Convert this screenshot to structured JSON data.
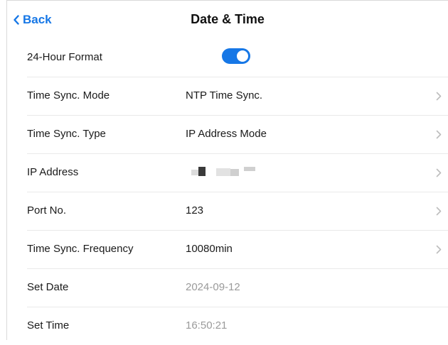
{
  "header": {
    "back_label": "Back",
    "title": "Date & Time"
  },
  "rows": [
    {
      "label": "24-Hour Format",
      "toggle_on": true
    },
    {
      "label": "Time Sync. Mode",
      "value": "NTP Time Sync."
    },
    {
      "label": "Time Sync. Type",
      "value": "IP Address Mode"
    },
    {
      "label": "IP Address",
      "value_redacted": true
    },
    {
      "label": "Port No.",
      "value": "123"
    },
    {
      "label": "Time Sync. Frequency",
      "value": "10080min"
    },
    {
      "label": "Set Date",
      "value": "2024-09-12"
    },
    {
      "label": "Set Time",
      "value": "16:50:21"
    }
  ],
  "colors": {
    "accent": "#1677e6",
    "muted_text": "#9a9a9a",
    "divider": "#e9e9e9"
  },
  "icons": [
    "chevron-left-icon",
    "chevron-right-icon"
  ]
}
